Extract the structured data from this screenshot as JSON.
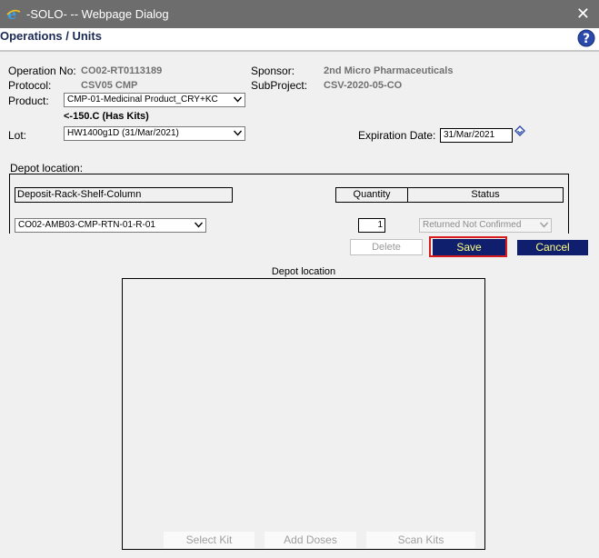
{
  "window": {
    "title": "-SOLO- -- Webpage Dialog",
    "close_label": "✕"
  },
  "header": {
    "title": "Operations / Units"
  },
  "operation": {
    "operation_no_label": "Operation No:",
    "operation_no": "CO02-RT0113189",
    "protocol_label": "Protocol:",
    "protocol": "CSV05 CMP",
    "sponsor_label": "Sponsor:",
    "sponsor": "2nd Micro Pharmaceuticals",
    "subproject_label": "SubProject:",
    "subproject": "CSV-2020-05-CO"
  },
  "product": {
    "label": "Product:",
    "value": "CMP-01-Medicinal Product_CRY+KC",
    "note": "<-150.C  (Has Kits)"
  },
  "lot": {
    "label": "Lot:",
    "value": "HW1400g1D (31/Mar/2021)",
    "expiration_label": "Expiration Date:",
    "expiration_value": "31/Mar/2021"
  },
  "depot": {
    "section_label": "Depot location:",
    "columns": [
      "Deposit-Rack-Shelf-Column",
      "Quantity",
      "Status"
    ],
    "location_value": "CO02-AMB03-CMP-RTN-01-R-01",
    "quantity_value": "1",
    "status_value": "Returned Not Confirmed"
  },
  "actions": {
    "delete_label": "Delete",
    "save_label": "Save",
    "cancel_label": "Cancel"
  },
  "grid": {
    "title": "Depot location",
    "select_kit_label": "Select Kit",
    "add_doses_label": "Add Doses",
    "scan_kits_label": "Scan Kits"
  },
  "colors": {
    "titlebar": "#6d6d6d",
    "accent_button": "#0f1f6e",
    "button_text": "#ffff80",
    "highlight": "#d61c1c"
  }
}
